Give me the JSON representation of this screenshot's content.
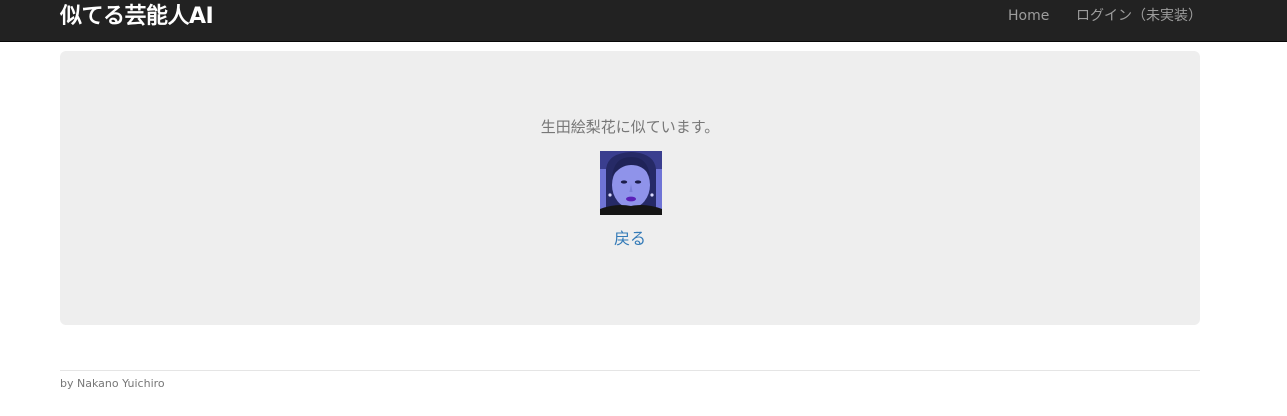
{
  "navbar": {
    "brand": "似てる芸能人AI",
    "links": [
      {
        "label": "Home"
      },
      {
        "label": "ログイン（未実装）"
      }
    ]
  },
  "result": {
    "text": "生田絵梨花に似ています。",
    "back_label": "戻る"
  },
  "footer": {
    "text": "by Nakano Yuichiro"
  }
}
